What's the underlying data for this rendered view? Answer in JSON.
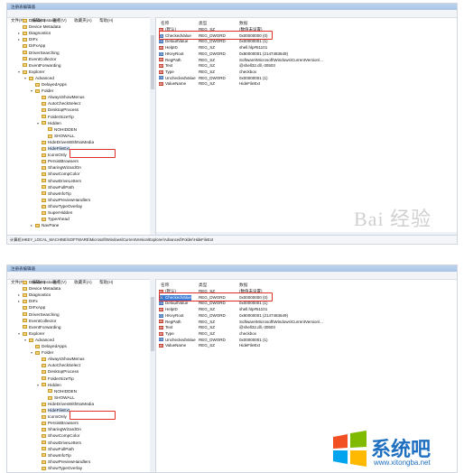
{
  "title": "注册表编辑器",
  "menu": [
    "文件(F)",
    "编辑(E)",
    "查看(V)",
    "收藏夹(A)",
    "帮助(H)"
  ],
  "columns": {
    "name": "名称",
    "type": "类型",
    "data": "数据"
  },
  "tree": [
    {
      "label": "Device Installer",
      "level": 5,
      "exp": ""
    },
    {
      "label": "Device Metadata",
      "level": 5,
      "exp": ""
    },
    {
      "label": "Diagnostics",
      "level": 5,
      "exp": "▸"
    },
    {
      "label": "DIFx",
      "level": 5,
      "exp": "▸"
    },
    {
      "label": "DIFxApp",
      "level": 5,
      "exp": ""
    },
    {
      "label": "DriverSearching",
      "level": 5,
      "exp": ""
    },
    {
      "label": "EventCollector",
      "level": 5,
      "exp": ""
    },
    {
      "label": "EventForwarding",
      "level": 5,
      "exp": ""
    },
    {
      "label": "Explorer",
      "level": 5,
      "exp": "▾"
    },
    {
      "label": "Advanced",
      "level": 6,
      "exp": "▾"
    },
    {
      "label": "DelayedApps",
      "level": 7,
      "exp": ""
    },
    {
      "label": "Folder",
      "level": 7,
      "exp": "▾"
    },
    {
      "label": "AlwaysShowMenus",
      "level": 8,
      "exp": ""
    },
    {
      "label": "AutoCheckSelect",
      "level": 8,
      "exp": ""
    },
    {
      "label": "DesktopProcess",
      "level": 8,
      "exp": ""
    },
    {
      "label": "FolderSizeTip",
      "level": 8,
      "exp": ""
    },
    {
      "label": "Hidden",
      "level": 8,
      "exp": "▾"
    },
    {
      "label": "NOHIDDEN",
      "level": 9,
      "exp": ""
    },
    {
      "label": "SHOWALL",
      "level": 9,
      "exp": ""
    },
    {
      "label": "HideDrivesWithNoMedia",
      "level": 8,
      "exp": ""
    },
    {
      "label": "HideFileExt",
      "level": 8,
      "exp": "",
      "selected": true
    },
    {
      "label": "IconsOnly",
      "level": 8,
      "exp": ""
    },
    {
      "label": "PersistBrowsers",
      "level": 8,
      "exp": ""
    },
    {
      "label": "SharingWizardOn",
      "level": 8,
      "exp": ""
    },
    {
      "label": "ShowCompColor",
      "level": 8,
      "exp": ""
    },
    {
      "label": "ShowDriveLetters",
      "level": 8,
      "exp": ""
    },
    {
      "label": "ShowFullPath",
      "level": 8,
      "exp": ""
    },
    {
      "label": "ShowInfoTip",
      "level": 8,
      "exp": ""
    },
    {
      "label": "ShowPreviewHandlers",
      "level": 8,
      "exp": ""
    },
    {
      "label": "ShowTypeOverlay",
      "level": 8,
      "exp": ""
    },
    {
      "label": "SuperHidden",
      "level": 8,
      "exp": ""
    },
    {
      "label": "TypeAhead",
      "level": 8,
      "exp": ""
    },
    {
      "label": "NavPane",
      "level": 7,
      "exp": "▸"
    }
  ],
  "values": [
    {
      "icon": "string-icon",
      "icon_text": "ab",
      "name": "(默认)",
      "type": "REG_SZ",
      "data": "(数值未设置)"
    },
    {
      "icon": "dword-icon",
      "icon_text": "01",
      "name": "CheckedValue",
      "type": "REG_DWORD",
      "data": "0x00000000 (0)",
      "highlight": true
    },
    {
      "icon": "dword-icon",
      "icon_text": "01",
      "name": "DefaultValue",
      "type": "REG_DWORD",
      "data": "0x00000001 (1)"
    },
    {
      "icon": "string-icon",
      "icon_text": "ab",
      "name": "HelpID",
      "type": "REG_SZ",
      "data": "shell.hlp#51101"
    },
    {
      "icon": "dword-icon",
      "icon_text": "01",
      "name": "HKeyRoot",
      "type": "REG_DWORD",
      "data": "0x80000001 (2147483649)"
    },
    {
      "icon": "string-icon",
      "icon_text": "ab",
      "name": "RegPath",
      "type": "REG_SZ",
      "data": "Software\\Microsoft\\Windows\\CurrentVersion\\..."
    },
    {
      "icon": "string-icon",
      "icon_text": "ab",
      "name": "Text",
      "type": "REG_SZ",
      "data": "@shell32.dll,-30503"
    },
    {
      "icon": "string-icon",
      "icon_text": "ab",
      "name": "Type",
      "type": "REG_SZ",
      "data": "checkbox"
    },
    {
      "icon": "dword-icon",
      "icon_text": "01",
      "name": "UncheckedValue",
      "type": "REG_DWORD",
      "data": "0x00000001 (1)"
    },
    {
      "icon": "string-icon",
      "icon_text": "ab",
      "name": "ValueName",
      "type": "REG_SZ",
      "data": "HideFileExt"
    }
  ],
  "status": "计算机\\HKEY_LOCAL_MACHINE\\SOFTWARE\\Microsoft\\Windows\\CurrentVersion\\Explorer\\Advanced\\Folder\\HideFileExt",
  "watermark_top": "Bai 经验",
  "watermark_bottom": {
    "brand": "系统吧",
    "url": "www.xitongba.net"
  }
}
